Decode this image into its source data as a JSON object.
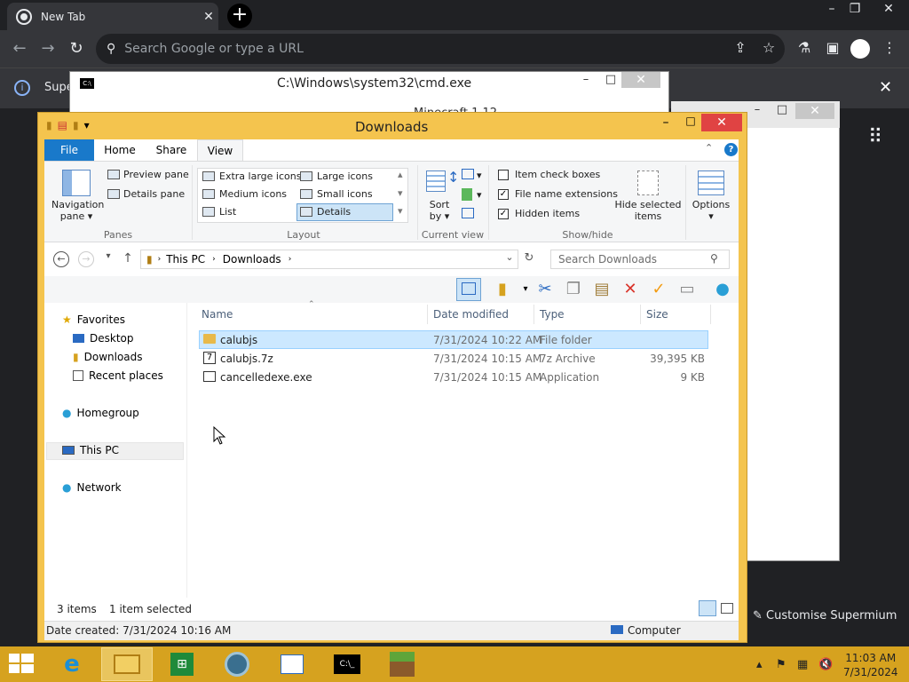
{
  "browser": {
    "tab_title": "New Tab",
    "tab_close": "✕",
    "new_tab": "+",
    "omnibox_placeholder": "Search Google or type a URL",
    "infobar_text": "Supe",
    "customise_label": "Customise Supermium"
  },
  "cmd_window": {
    "title": "C:\\Windows\\system32\\cmd.exe"
  },
  "minecraft_window": {
    "title": "Minecraft 1.12"
  },
  "explorer": {
    "title": "Downloads",
    "tabs": [
      "File",
      "Home",
      "Share",
      "View"
    ],
    "ribbon": {
      "panes": {
        "navigation_pane": "Navigation",
        "navigation_pane_2": "pane ▾",
        "preview_pane": "Preview pane",
        "details_pane": "Details pane",
        "label": "Panes"
      },
      "layout": {
        "extra_large": "Extra large icons",
        "large": "Large icons",
        "medium": "Medium icons",
        "small": "Small icons",
        "list": "List",
        "details": "Details",
        "label": "Layout"
      },
      "current_view": {
        "sort_by": "Sort",
        "sort_by_2": "by ▾",
        "label": "Current view"
      },
      "show_hide": {
        "item_check_boxes": "Item check boxes",
        "file_name_extensions": "File name extensions",
        "hidden_items": "Hidden items",
        "hide_selected": "Hide selected",
        "hide_selected_2": "items",
        "label": "Show/hide",
        "checked": {
          "item_check_boxes": false,
          "file_name_extensions": true,
          "hidden_items": true
        }
      },
      "options": "Options"
    },
    "address": {
      "segments": [
        "This PC",
        "Downloads"
      ],
      "search_placeholder": "Search Downloads"
    },
    "nav_pane": {
      "favorites": "Favorites",
      "favorites_items": [
        "Desktop",
        "Downloads",
        "Recent places"
      ],
      "homegroup": "Homegroup",
      "this_pc": "This PC",
      "network": "Network"
    },
    "columns": [
      "Name",
      "Date modified",
      "Type",
      "Size"
    ],
    "files": [
      {
        "name": "calubjs",
        "date": "7/31/2024 10:22 AM",
        "type": "File folder",
        "size": ""
      },
      {
        "name": "calubjs.7z",
        "date": "7/31/2024 10:15 AM",
        "type": "7z Archive",
        "size": "39,395 KB"
      },
      {
        "name": "cancelledexe.exe",
        "date": "7/31/2024 10:15 AM",
        "type": "Application",
        "size": "9 KB"
      }
    ],
    "status": {
      "items": "3 items",
      "selected": "1 item selected"
    },
    "details": {
      "date_created": "Date created: 7/31/2024 10:16 AM",
      "location": "Computer"
    }
  },
  "taskbar": {
    "time": "11:03 AM",
    "date": "7/31/2024"
  },
  "colors": {
    "accent": "#1979ca",
    "taskbar": "#d6a21f",
    "window_frame": "#f4c44e",
    "selection": "#cce8ff"
  }
}
